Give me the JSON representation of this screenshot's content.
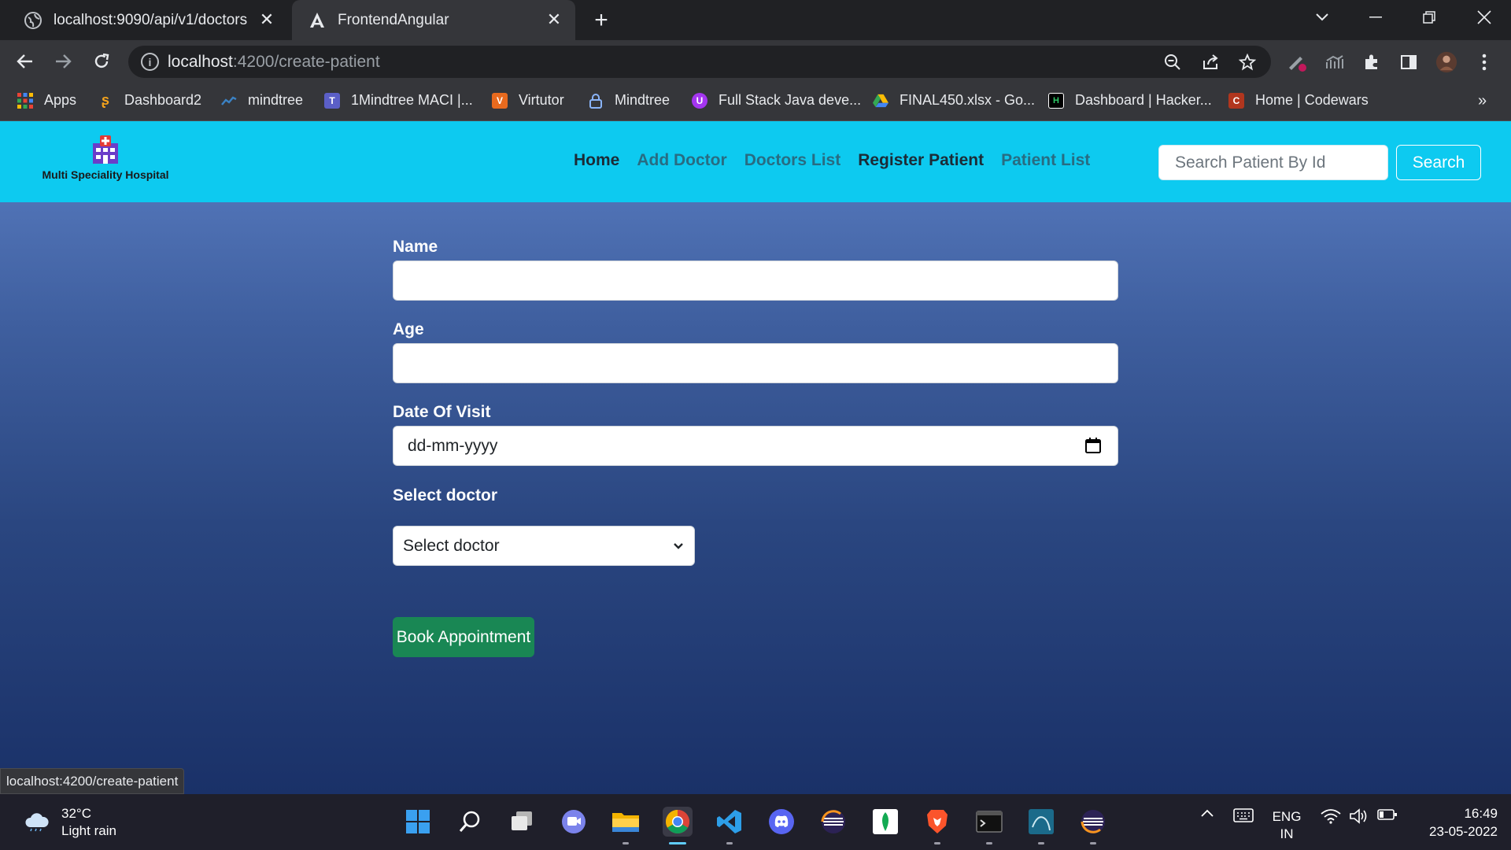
{
  "browser": {
    "tabs": [
      {
        "title": "localhost:9090/api/v1/doctors",
        "icon": "globe-icon",
        "active": false
      },
      {
        "title": "FrontendAngular",
        "icon": "angular-icon",
        "active": true
      }
    ],
    "address": {
      "host": "localhost",
      "path": ":4200/create-patient"
    },
    "bookmarks": [
      {
        "label": "Apps",
        "icon": "apps-grid-icon",
        "color": "#ea4335"
      },
      {
        "label": "Dashboard2",
        "icon": "dashboard-icon",
        "color": "#f4a31c"
      },
      {
        "label": "mindtree",
        "icon": "mindtree-icon",
        "color": "#3b82c4"
      },
      {
        "label": "1Mindtree MACI |...",
        "icon": "teams-icon",
        "color": "#5b5fc7"
      },
      {
        "label": "Virtutor",
        "icon": "virtutor-icon",
        "color": "#e86a1e"
      },
      {
        "label": "Mindtree",
        "icon": "lock-icon",
        "color": "#8ab4f8"
      },
      {
        "label": "Full Stack Java deve...",
        "icon": "udemy-icon",
        "color": "#a435f0"
      },
      {
        "label": "FINAL450.xlsx - Go...",
        "icon": "drive-icon",
        "color": "#34a853"
      },
      {
        "label": "Dashboard | Hacker...",
        "icon": "hackerrank-icon",
        "color": "#000000"
      },
      {
        "label": "Home | Codewars",
        "icon": "codewars-icon",
        "color": "#b1361e"
      }
    ],
    "status_url": "localhost:4200/create-patient"
  },
  "app": {
    "brand": "Multi Speciality Hospital",
    "nav": [
      {
        "label": "Home",
        "style": "dark"
      },
      {
        "label": "Add Doctor",
        "style": "muted"
      },
      {
        "label": "Doctors List",
        "style": "muted"
      },
      {
        "label": "Register Patient",
        "style": "dark"
      },
      {
        "label": "Patient List",
        "style": "muted"
      }
    ],
    "search_placeholder": "Search Patient By Id",
    "search_button": "Search"
  },
  "form": {
    "name_label": "Name",
    "name_value": "",
    "age_label": "Age",
    "age_value": "",
    "date_label": "Date Of Visit",
    "date_placeholder": "dd-mm-yyyy",
    "doctor_label": "Select doctor",
    "doctor_selected": "Select doctor",
    "submit": "Book Appointment"
  },
  "taskbar": {
    "weather_temp": "32°C",
    "weather_desc": "Light rain",
    "lang_top": "ENG",
    "lang_bottom": "IN",
    "time": "16:49",
    "date": "23-05-2022"
  }
}
